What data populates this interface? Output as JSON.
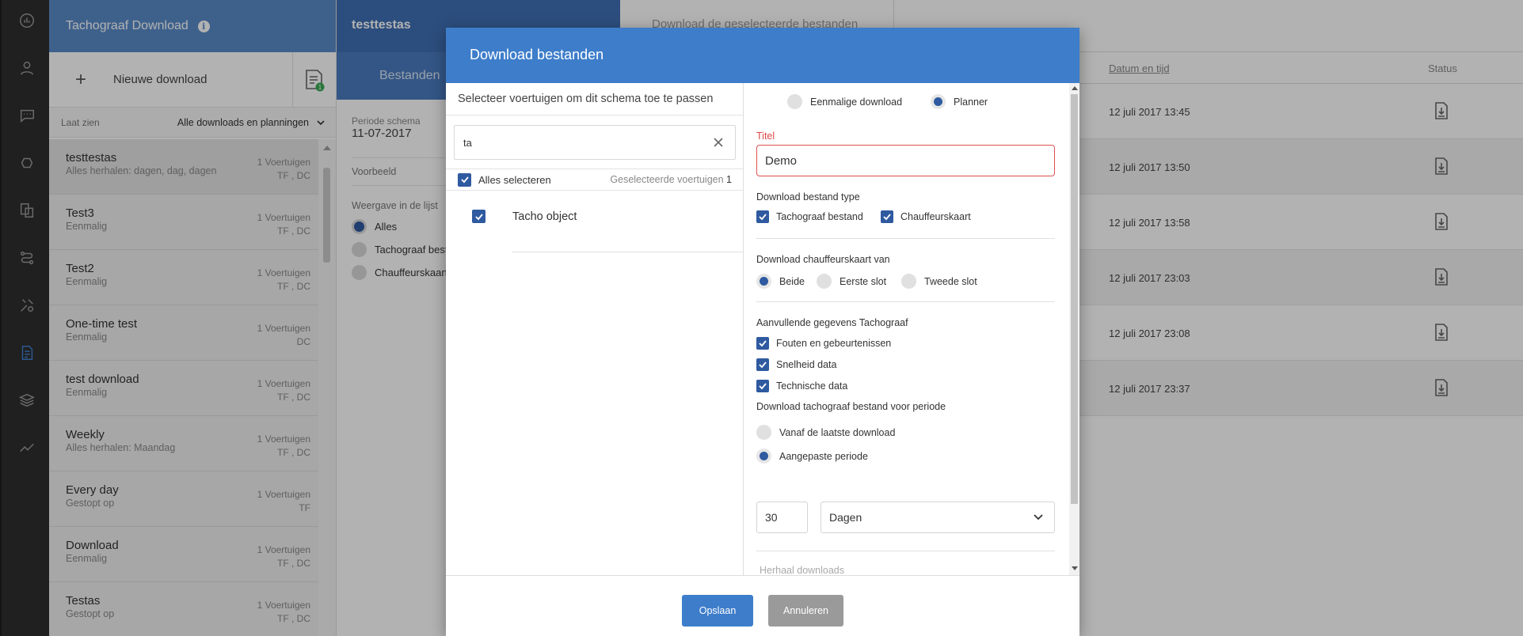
{
  "list": {
    "title": "Tachograaf Download",
    "new_download": "Nieuwe download",
    "badge_count": "1",
    "filter_label": "Laat zien",
    "filter_value": "Alle downloads en planningen",
    "items": [
      {
        "name": "testtestas",
        "sub": "Alles herhalen: dagen, dag, dagen",
        "count": "1 Voertuigen",
        "type": "TF , DC"
      },
      {
        "name": "Test3",
        "sub": "Eenmalig",
        "count": "1 Voertuigen",
        "type": "TF , DC"
      },
      {
        "name": "Test2",
        "sub": "Eenmalig",
        "count": "1 Voertuigen",
        "type": "TF , DC"
      },
      {
        "name": "One-time test",
        "sub": "Eenmalig",
        "count": "1 Voertuigen",
        "type": "DC"
      },
      {
        "name": "test download",
        "sub": "Eenmalig",
        "count": "1 Voertuigen",
        "type": "TF , DC"
      },
      {
        "name": "Weekly",
        "sub": "Alles herhalen: Maandag",
        "count": "1 Voertuigen",
        "type": "TF , DC"
      },
      {
        "name": "Every day",
        "sub": "Gestopt op",
        "count": "1 Voertuigen",
        "type": "TF"
      },
      {
        "name": "Download",
        "sub": "Eenmalig",
        "count": "1 Voertuigen",
        "type": "TF , DC"
      },
      {
        "name": "Testas",
        "sub": "Gestopt op",
        "count": "1 Voertuigen",
        "type": "TF , DC"
      }
    ]
  },
  "detail": {
    "title": "testtestas",
    "tab": "Bestanden",
    "period_label": "Periode schema",
    "period_value": "11-07-2017",
    "preview": "Voorbeeld",
    "view_label": "Weergave in de lijst",
    "view_options": [
      "Alles",
      "Tachograaf bestand",
      "Chauffeurskaart"
    ]
  },
  "right": {
    "top_title": "Download de geselecteerde bestanden",
    "col_date": "Datum en tijd",
    "col_status": "Status",
    "rows": [
      "12 juli 2017 13:45",
      "12 juli 2017 13:50",
      "12 juli 2017 13:58",
      "12 juli 2017 23:03",
      "12 juli 2017 23:08",
      "12 juli 2017 23:37"
    ]
  },
  "modal": {
    "title": "Download bestanden",
    "left_hint": "Selecteer voertuigen om dit schema toe te passen",
    "search_value": "ta",
    "select_all": "Alles selecteren",
    "selected_label": "Geselecteerde voertuigen",
    "selected_count": "1",
    "vehicle": "Tacho object",
    "mode_once": "Eenmalige download",
    "mode_planner": "Planner",
    "titel_label": "Titel",
    "titel_value": "Demo",
    "file_type_label": "Download bestand type",
    "file_type_tacho": "Tachograaf bestand",
    "file_type_card": "Chauffeurskaart",
    "card_from_label": "Download chauffeurskaart van",
    "slot_both": "Beide",
    "slot_first": "Eerste slot",
    "slot_second": "Tweede slot",
    "extra_label": "Aanvullende gegevens Tachograaf",
    "extra_faults": "Fouten en gebeurtenissen",
    "extra_speed": "Snelheid data",
    "extra_tech": "Technische data",
    "period_label": "Download tachograaf bestand voor periode",
    "period_last": "Vanaf de laatste download",
    "period_custom": "Aangepaste periode",
    "period_num": "30",
    "period_unit": "Dagen",
    "repeat_label": "Herhaal downloads",
    "save": "Opslaan",
    "cancel": "Annuleren"
  },
  "colors": {
    "primary": "#3d7dca",
    "checkbox": "#2f5aa0",
    "error": "#e05050"
  }
}
